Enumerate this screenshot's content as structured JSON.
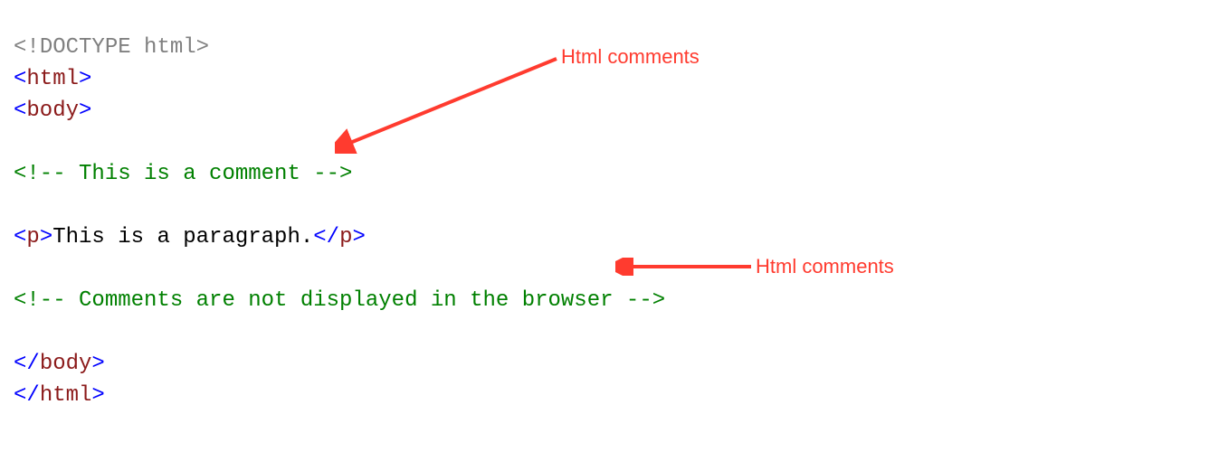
{
  "code": {
    "doctype_open": "<!",
    "doctype_word": "DOCTYPE",
    "doctype_rest": " html",
    "doctype_close": ">",
    "lt": "<",
    "lt_close": "</",
    "gt": ">",
    "tag_html": "html",
    "tag_body": "body",
    "tag_p": "p",
    "comment1": "<!-- This is a comment -->",
    "comment2": "<!-- Comments are not displayed in the browser -->",
    "paragraph_text": "This is a paragraph."
  },
  "annotations": {
    "label1": "Html comments",
    "label2": "Html comments"
  },
  "colors": {
    "gray": "#808080",
    "blue": "#0000ff",
    "maroon": "#8b1a1a",
    "green": "#008000",
    "black": "#000000",
    "arrow": "#ff3b2f"
  }
}
